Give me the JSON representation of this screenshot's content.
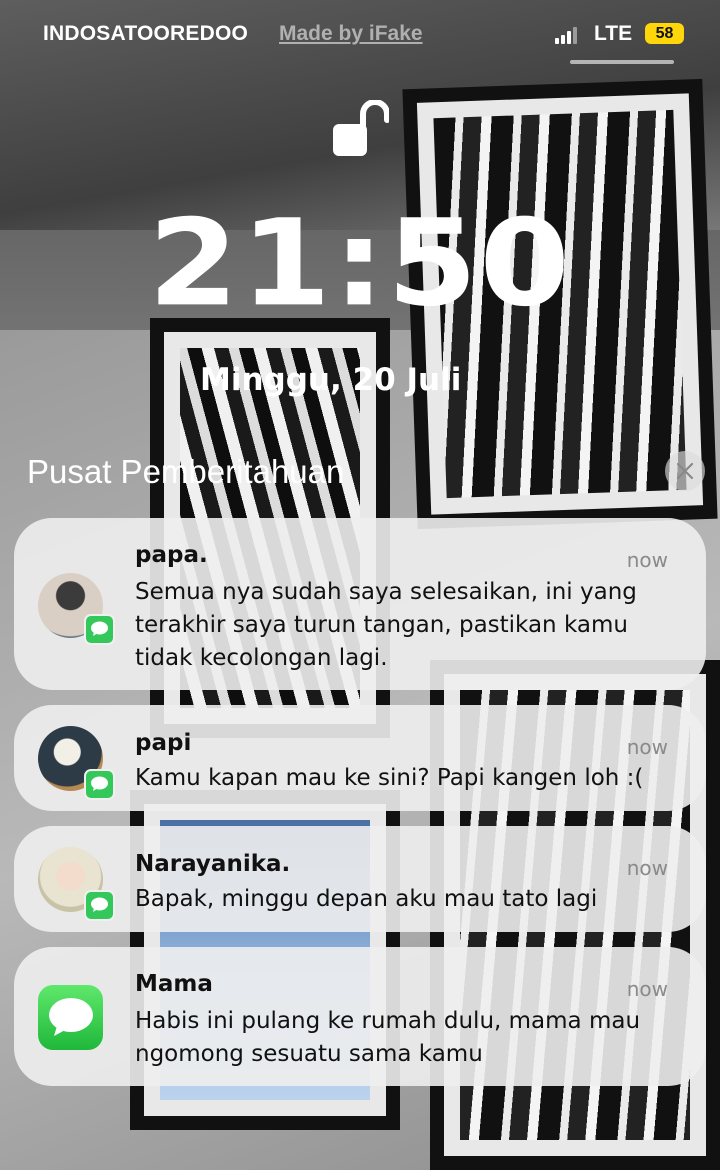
{
  "status_bar": {
    "carrier": "INDOSATOOREDOO",
    "watermark": "Made by iFake",
    "network": "LTE",
    "battery_level": "58",
    "signal_icon": "cellular-signal-icon",
    "battery_color": "#ffd60a"
  },
  "lock_screen": {
    "lock_icon": "unlocked-padlock-icon",
    "time": "21:50",
    "date": "Minggu, 20 Juli"
  },
  "notification_center": {
    "title": "Pusat Pemberitahuan",
    "clear_icon": "close-icon",
    "notifications": [
      {
        "sender": "papa.",
        "time": "now",
        "message": "Semua nya sudah saya selesaikan, ini yang terakhir saya turun tangan, pastikan kamu tidak kecolongan lagi.",
        "icon": "contact-avatar"
      },
      {
        "sender": "papi",
        "time": "now",
        "message": "Kamu kapan mau ke sini? Papi kangen loh :(",
        "icon": "contact-avatar"
      },
      {
        "sender": "Narayanika.",
        "time": "now",
        "message": "Bapak, minggu depan aku mau tato lagi",
        "icon": "contact-avatar"
      },
      {
        "sender": "Mama",
        "time": "now",
        "message": "Habis ini pulang ke rumah dulu, mama mau ngomong sesuatu sama kamu",
        "icon": "messages-app-icon"
      }
    ],
    "messages_color": "#34c759"
  }
}
